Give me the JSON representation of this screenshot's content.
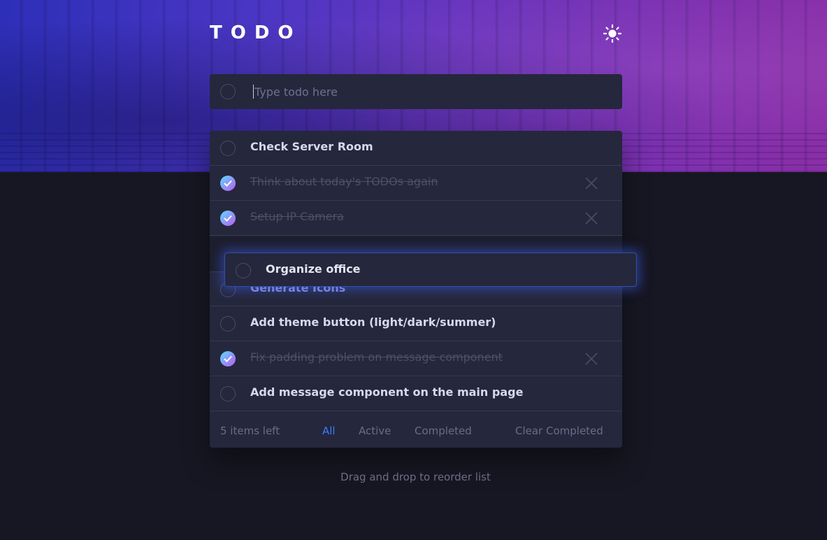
{
  "app": {
    "title": "TODO",
    "theme_icon": "sun-icon"
  },
  "input": {
    "placeholder": "Type todo here",
    "value": ""
  },
  "todos": [
    {
      "text": "Check Server Room",
      "completed": false
    },
    {
      "text": "Think about today's TODOs again",
      "completed": true
    },
    {
      "text": "Setup IP Camera",
      "completed": true
    },
    {
      "text": "Generate Icons",
      "completed": false
    },
    {
      "text": "Add theme button (light/dark/summer)",
      "completed": false
    },
    {
      "text": "Fix padding problem on message component",
      "completed": true
    },
    {
      "text": "Add message component on the main page",
      "completed": false
    }
  ],
  "dragging": {
    "text": "Organize office",
    "completed": false
  },
  "footer": {
    "items_left": "5 items left",
    "filter_all": "All",
    "filter_active": "Active",
    "filter_completed": "Completed",
    "clear_completed": "Clear Completed",
    "selected_filter": "All"
  },
  "hint": "Drag and drop to reorder list",
  "colors": {
    "background": "#171723",
    "card": "#25273c",
    "accent": "#3a7cfd",
    "check_gradient_start": "#57ddff",
    "check_gradient_end": "#c058f3"
  }
}
